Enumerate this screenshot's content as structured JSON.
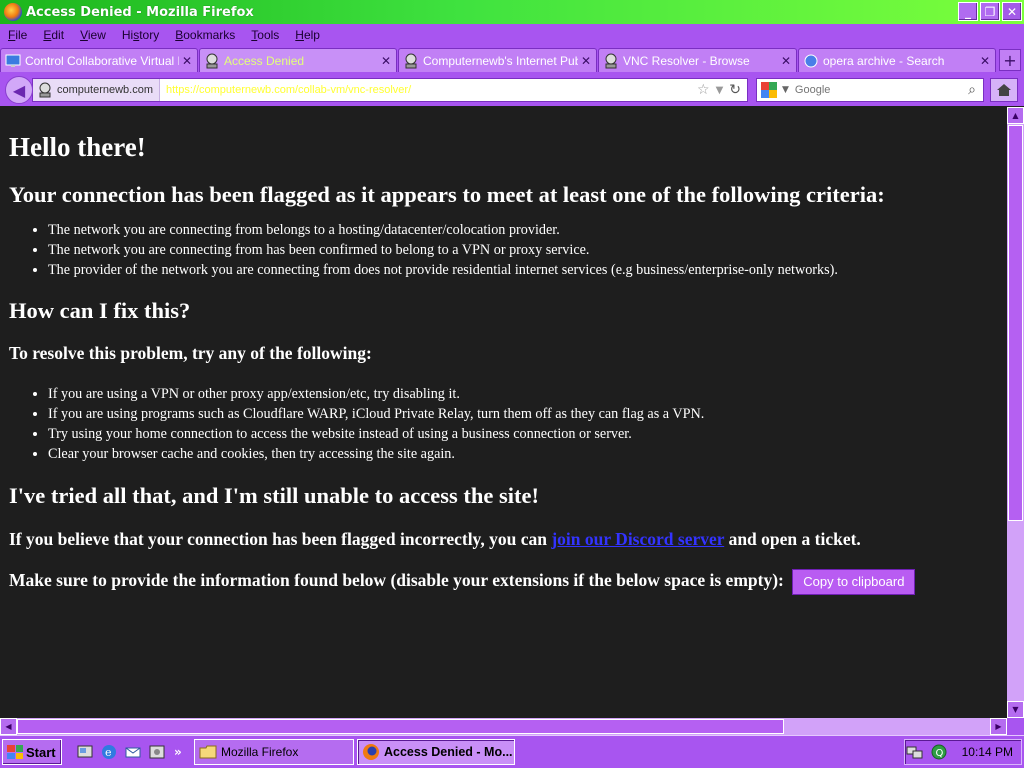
{
  "window": {
    "title": "Access Denied - Mozilla Firefox",
    "controls": {
      "minimize": "_",
      "restore": "❐",
      "close": "✕"
    }
  },
  "menu": [
    {
      "key": "F",
      "rest": "ile"
    },
    {
      "key": "E",
      "rest": "dit"
    },
    {
      "key": "V",
      "rest": "iew"
    },
    {
      "pre": "Hi",
      "key": "s",
      "rest": "tory"
    },
    {
      "key": "B",
      "rest": "ookmarks"
    },
    {
      "key": "T",
      "rest": "ools"
    },
    {
      "key": "H",
      "rest": "elp"
    }
  ],
  "tabs": [
    {
      "title": "Control Collaborative Virtual Ma...",
      "close": "✕",
      "icon": "monitor-icon"
    },
    {
      "title": "Access Denied",
      "close": "✕",
      "icon": "network-icon"
    },
    {
      "title": "Computernewb's Internet Pub H...",
      "close": "✕",
      "icon": "network-icon"
    },
    {
      "title": "VNC Resolver - Browse",
      "close": "✕",
      "icon": "network-icon"
    },
    {
      "title": "opera archive - Search",
      "close": "✕",
      "icon": "search-tab-icon"
    }
  ],
  "newtab": "+",
  "nav": {
    "site_identity": "computernewb.com",
    "url": "https://computernewb.com/collab-vm/vnc-resolver/",
    "search_placeholder": "Google",
    "back": "◀"
  },
  "page": {
    "heading": "Hello there!",
    "flagged_heading": "Your connection has been flagged as it appears to meet at least one of the following criteria:",
    "criteria": [
      "The network you are connecting from belongs to a hosting/datacenter/colocation provider.",
      "The network you are connecting from has been confirmed to belong to a VPN or proxy service.",
      "The provider of the network you are connecting from does not provide residential internet services (e.g business/enterprise-only networks)."
    ],
    "fix_heading": "How can I fix this?",
    "resolve_heading": "To resolve this problem, try any of the following:",
    "fixes": [
      "If you are using a VPN or other proxy app/extension/etc, try disabling it.",
      "If you are using programs such as Cloudflare WARP, iCloud Private Relay, turn them off as they can flag as a VPN.",
      "Try using your home connection to access the website instead of using a business connection or server.",
      "Clear your browser cache and cookies, then try accessing the site again."
    ],
    "tried_heading": "I've tried all that, and I'm still unable to access the site!",
    "incorrect_pre": "If you believe that your connection has been flagged incorrectly, you can ",
    "discord_link": "join our Discord server",
    "incorrect_post": " and open a ticket.",
    "provide_info": "Make sure to provide the information found below (disable your extensions if the below space is empty):",
    "copy_button": "Copy to clipboard"
  },
  "taskbar": {
    "start": "Start",
    "tasks": [
      {
        "label": "Mozilla Firefox",
        "icon": "folder-icon"
      },
      {
        "label": "Access Denied - Mo...",
        "icon": "firefox-icon"
      }
    ],
    "clock": "10:14 PM",
    "quicklaunch_more": "»"
  },
  "colors": {
    "accent": "#a855f0",
    "titlebar": "#3fe23f",
    "page_bg": "#1e1e1e",
    "link": "#3333ff",
    "url_text": "#ffff33"
  }
}
